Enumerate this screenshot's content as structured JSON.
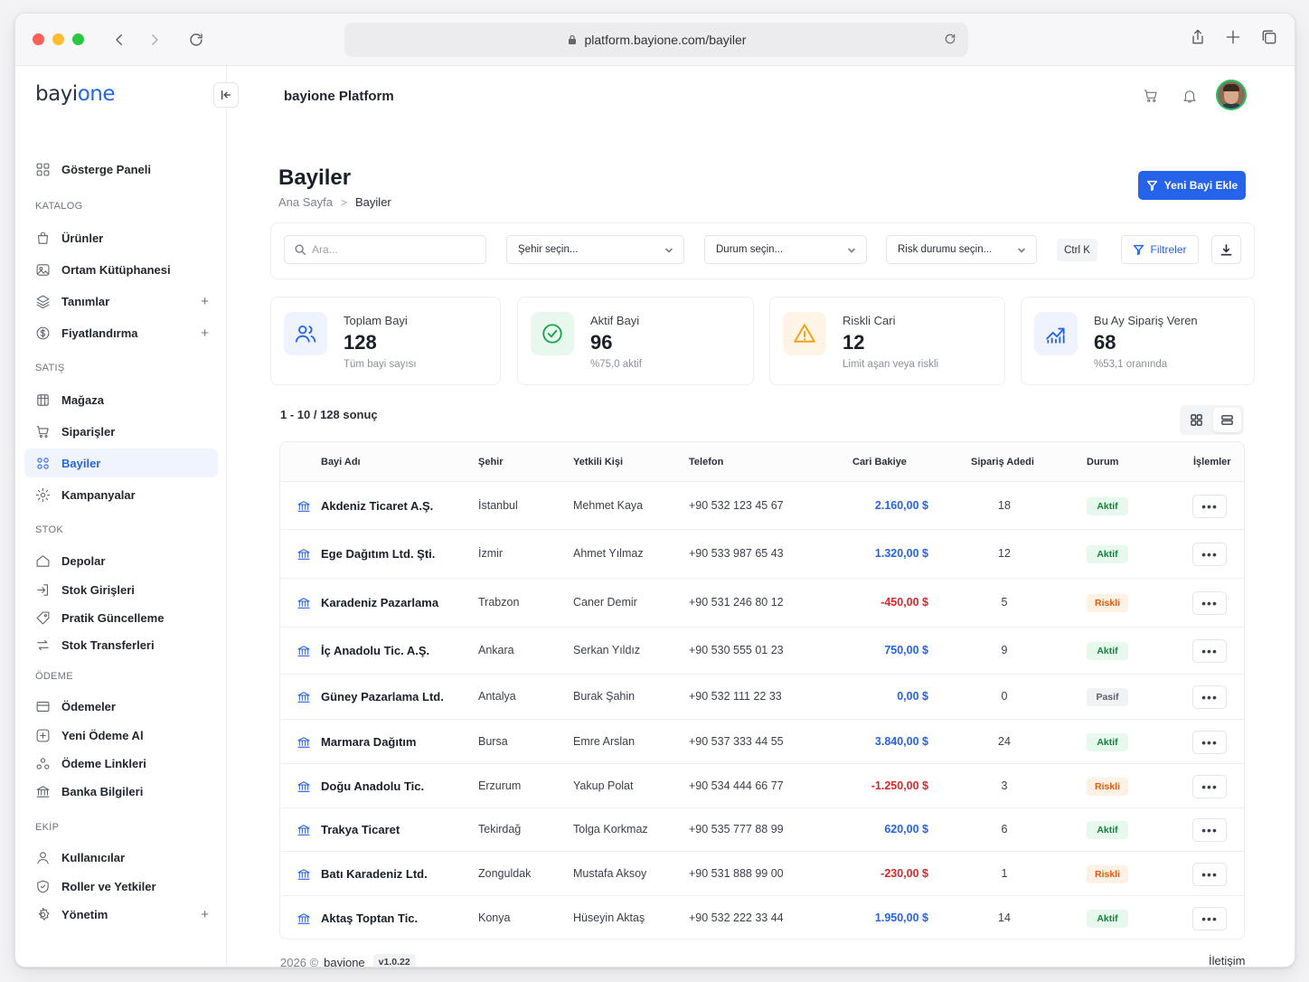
{
  "browser": {
    "url": "platform.bayione.com/bayiler"
  },
  "logo": {
    "part1": "bayi",
    "part2": "one"
  },
  "app_title": "bayione Platform",
  "nav": {
    "dashboard": "Gösterge Paneli",
    "sections": [
      "KATALOG",
      "SATIŞ",
      "STOK",
      "ÖDEME",
      "EKİP"
    ],
    "items": [
      {
        "label": "Ürünler",
        "icon": "bag-icon"
      },
      {
        "label": "Ortam Kütüphanesi",
        "icon": "image-icon"
      },
      {
        "label": "Tanımlar",
        "icon": "layers-icon",
        "expandable": "+"
      },
      {
        "label": "Fiyatlandırma",
        "icon": "dollar-icon",
        "expandable": "+"
      },
      {
        "label": "Mağaza",
        "icon": "store-icon"
      },
      {
        "label": "Siparişler",
        "icon": "cart-icon"
      },
      {
        "label": "Bayiler",
        "icon": "dealers-icon",
        "active": true
      },
      {
        "label": "Kampanyalar",
        "icon": "gear-icon"
      },
      {
        "label": "Depolar",
        "icon": "home-icon"
      },
      {
        "label": "Stok Girişleri",
        "icon": "login-icon"
      },
      {
        "label": "Pratik Güncelleme",
        "icon": "tag-icon"
      },
      {
        "label": "Stok Transferleri",
        "icon": "transfer-icon"
      },
      {
        "label": "Ödemeler",
        "icon": "card-icon"
      },
      {
        "label": "Yeni Ödeme Al",
        "icon": "plus-square-icon"
      },
      {
        "label": "Ödeme Linkleri",
        "icon": "link-people-icon"
      },
      {
        "label": "Banka Bilgileri",
        "icon": "bank-icon"
      },
      {
        "label": "Kullanıcılar",
        "icon": "user-icon"
      },
      {
        "label": "Roller ve Yetkiler",
        "icon": "shield-icon"
      },
      {
        "label": "Yönetim",
        "icon": "settings-icon",
        "expandable": "+"
      }
    ]
  },
  "page": {
    "title": "Bayiler",
    "breadcrumb": [
      "Ana Sayfa",
      "Bayiler"
    ],
    "add_button": "Yeni Bayi Ekle"
  },
  "filters": {
    "search_placeholder": "Ara...",
    "city": "Şehir seçin...",
    "status": "Durum seçin...",
    "risk": "Risk durumu seçin...",
    "shortcut": "Ctrl K",
    "filter_button": "Filtreler"
  },
  "stats": [
    {
      "label": "Toplam Bayi",
      "value": "128",
      "sub": "Tüm bayi sayısı",
      "icon": "users-icon",
      "color": "#2563eb",
      "bg": "#eef3ff"
    },
    {
      "label": "Aktif Bayi",
      "value": "96",
      "sub": "%75,0 aktif",
      "icon": "check-circle-icon",
      "color": "#16a34a",
      "bg": "#e9f8ee"
    },
    {
      "label": "Riskli Cari",
      "value": "12",
      "sub": "Limit aşan veya riskli",
      "icon": "warning-icon",
      "color": "#f59e0b",
      "bg": "#fff4e5"
    },
    {
      "label": "Bu Ay Sipariş Veren",
      "value": "68",
      "sub": "%53,1 oranında",
      "icon": "chart-up-icon",
      "color": "#2563eb",
      "bg": "#eef3ff"
    }
  ],
  "results": {
    "summary": "1 - 10 / 128 sonuç"
  },
  "table": {
    "headers": [
      "Bayi Adı",
      "Şehir",
      "Yetkili Kişi",
      "Telefon",
      "Cari Bakiye",
      "Sipariş Adedi",
      "Durum",
      "İşlemler"
    ],
    "rows": [
      {
        "name": "Akdeniz Ticaret A.Ş.",
        "city": "İstanbul",
        "contact": "Mehmet Kaya",
        "phone": "+90 532 123 45 67",
        "balance": "2.160,00 $",
        "orders": "18",
        "status": "Aktif"
      },
      {
        "name": "Ege Dağıtım Ltd. Şti.",
        "city": "İzmir",
        "contact": "Ahmet Yılmaz",
        "phone": "+90 533 987 65 43",
        "balance": "1.320,00 $",
        "orders": "12",
        "status": "Aktif"
      },
      {
        "name": "Karadeniz Pazarlama",
        "city": "Trabzon",
        "contact": "Caner Demir",
        "phone": "+90 531 246 80 12",
        "balance": "-450,00 $",
        "orders": "5",
        "status": "Riskli"
      },
      {
        "name": "İç Anadolu Tic. A.Ş.",
        "city": "Ankara",
        "contact": "Serkan Yıldız",
        "phone": "+90 530 555 01 23",
        "balance": "750,00 $",
        "orders": "9",
        "status": "Aktif"
      },
      {
        "name": "Güney Pazarlama Ltd.",
        "city": "Antalya",
        "contact": "Burak Şahin",
        "phone": "+90 532 111 22 33",
        "balance": "0,00 $",
        "orders": "0",
        "status": "Pasif"
      },
      {
        "name": "Marmara Dağıtım",
        "city": "Bursa",
        "contact": "Emre Arslan",
        "phone": "+90 537 333 44 55",
        "balance": "3.840,00 $",
        "orders": "24",
        "status": "Aktif"
      },
      {
        "name": "Doğu Anadolu Tic.",
        "city": "Erzurum",
        "contact": "Yakup Polat",
        "phone": "+90 534 444 66 77",
        "balance": "-1.250,00 $",
        "orders": "3",
        "status": "Riskli"
      },
      {
        "name": "Trakya Ticaret",
        "city": "Tekirdağ",
        "contact": "Tolga Korkmaz",
        "phone": "+90 535 777 88 99",
        "balance": "620,00 $",
        "orders": "6",
        "status": "Aktif"
      },
      {
        "name": "Batı Karadeniz Ltd.",
        "city": "Zonguldak",
        "contact": "Mustafa Aksoy",
        "phone": "+90 531 888 99 00",
        "balance": "-230,00 $",
        "orders": "1",
        "status": "Riskli"
      },
      {
        "name": "Aktaş Toptan Tic.",
        "city": "Konya",
        "contact": "Hüseyin Aktaş",
        "phone": "+90 532 222 33 44",
        "balance": "1.950,00 $",
        "orders": "14",
        "status": "Aktif"
      }
    ],
    "more_label": "•••"
  },
  "footer": {
    "year": "2026 ©",
    "brand": "bayione",
    "version": "v1.0.22",
    "contact": "İletişim"
  }
}
